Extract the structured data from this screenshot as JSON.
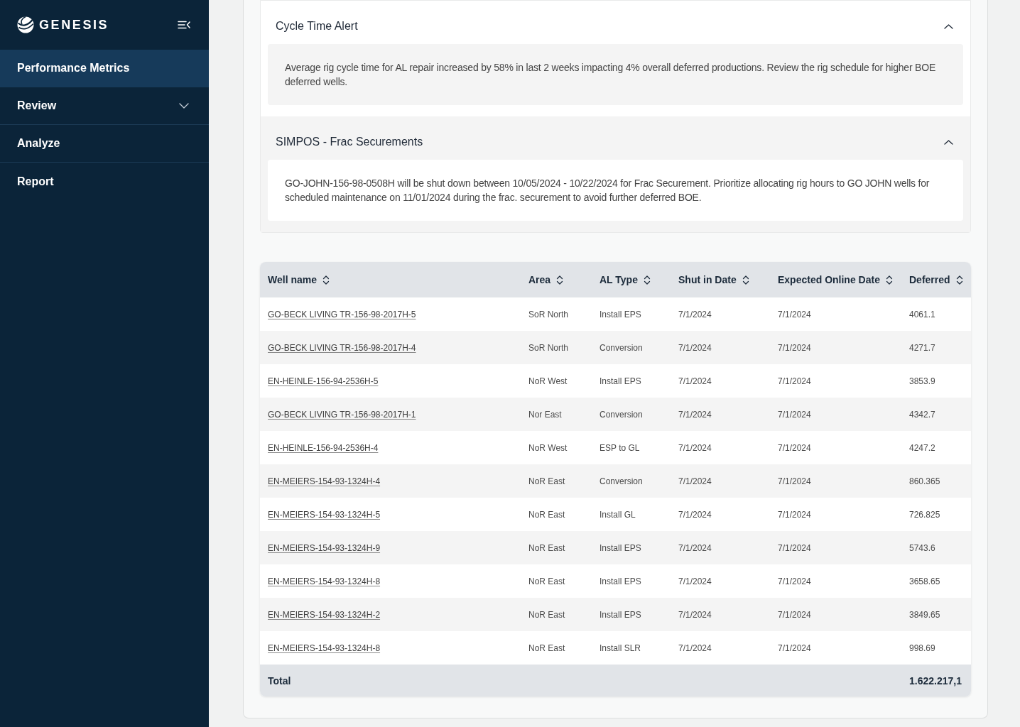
{
  "sidebar": {
    "brand": "GENESIS",
    "items": [
      {
        "label": "Performance Metrics",
        "kind": "link",
        "selected": true
      },
      {
        "label": "Review",
        "kind": "group",
        "selected": false
      },
      {
        "label": "Analyze",
        "kind": "link",
        "selected": false
      },
      {
        "label": "Report",
        "kind": "link",
        "selected": false
      }
    ]
  },
  "alerts": [
    {
      "title": "Cycle Time Alert",
      "expanded": true,
      "message": "Average rig cycle time for AL repair increased by 58% in last 2 weeks impacting 4% overall deferred productions. Review the rig schedule for higher BOE deferred wells."
    },
    {
      "title": "SIMPOS - Frac Securements",
      "expanded": true,
      "message": "GO-JOHN-156-98-0508H will be shut down between 10/05/2024 - 10/22/2024 for Frac Securement. Prioritize allocating rig hours to GO JOHN wells for scheduled maintenance on 11/01/2024 during the frac. securement to avoid further deferred BOE."
    }
  ],
  "table": {
    "columns": [
      {
        "label": "Well name",
        "sortable": true
      },
      {
        "label": "Area",
        "sortable": true
      },
      {
        "label": "AL Type",
        "sortable": true
      },
      {
        "label": "Shut in Date",
        "sortable": true
      },
      {
        "label": "Expected Online Date",
        "sortable": true
      },
      {
        "label": "Deferred",
        "sortable": true
      }
    ],
    "rows": [
      [
        "GO-BECK LIVING TR-156-98-2017H-5",
        "SoR North",
        "Install EPS",
        "7/1/2024",
        "7/1/2024",
        "4061.1"
      ],
      [
        "GO-BECK LIVING TR-156-98-2017H-4",
        "SoR North",
        "Conversion",
        "7/1/2024",
        "7/1/2024",
        "4271.7"
      ],
      [
        "EN-HEINLE-156-94-2536H-5",
        "NoR West",
        "Install EPS",
        "7/1/2024",
        "7/1/2024",
        "3853.9"
      ],
      [
        "GO-BECK LIVING TR-156-98-2017H-1",
        "Nor East",
        "Conversion",
        "7/1/2024",
        "7/1/2024",
        "4342.7"
      ],
      [
        "EN-HEINLE-156-94-2536H-4",
        "NoR West",
        "ESP to GL",
        "7/1/2024",
        "7/1/2024",
        "4247.2"
      ],
      [
        "EN-MEIERS-154-93-1324H-4",
        "NoR East",
        "Conversion",
        "7/1/2024",
        "7/1/2024",
        "860.365"
      ],
      [
        "EN-MEIERS-154-93-1324H-5",
        "NoR East",
        "Install GL",
        "7/1/2024",
        "7/1/2024",
        "726.825"
      ],
      [
        "EN-MEIERS-154-93-1324H-9",
        "NoR East",
        "Install EPS",
        "7/1/2024",
        "7/1/2024",
        "5743.6"
      ],
      [
        "EN-MEIERS-154-93-1324H-8",
        "NoR East",
        "Install EPS",
        "7/1/2024",
        "7/1/2024",
        "3658.65"
      ],
      [
        "EN-MEIERS-154-93-1324H-2",
        "NoR East",
        "Install EPS",
        "7/1/2024",
        "7/1/2024",
        "3849.65"
      ],
      [
        "EN-MEIERS-154-93-1324H-8",
        "NoR East",
        "Install SLR",
        "7/1/2024",
        "7/1/2024",
        "998.69"
      ]
    ],
    "total": {
      "label": "Total",
      "value": "1.622.217,1"
    }
  }
}
